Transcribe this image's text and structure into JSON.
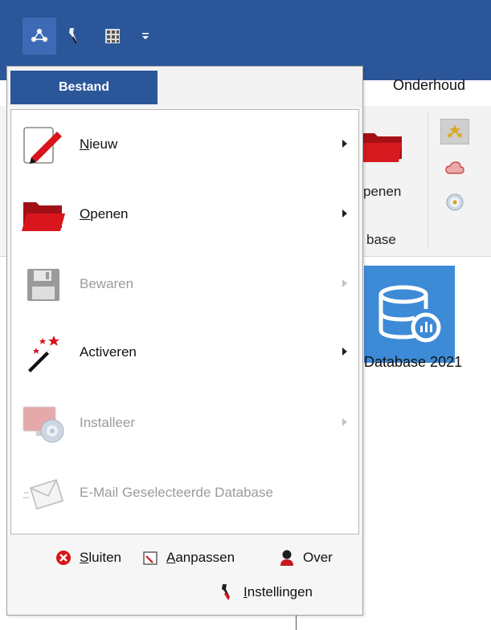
{
  "quick_access": {
    "icons": [
      "network-icon",
      "wrench-icon",
      "grid-icon",
      "customize-qat-icon"
    ],
    "colors": {
      "bar": "#2b579a",
      "active": "#3c6ab4"
    }
  },
  "ribbon": {
    "tab_right": "Onderhoud",
    "open_label": "penen",
    "group_label": "base",
    "small_icons": [
      "stars-icon",
      "cloud-icon",
      "cd-icon"
    ]
  },
  "database_tile": {
    "label": "Database 2021",
    "color": "#3d8ad6"
  },
  "file_menu": {
    "tab_label": "Bestand",
    "items": [
      {
        "label_hotkey": "N",
        "label_rest": "ieuw",
        "icon": "new-document-icon",
        "enabled": true,
        "has_submenu": true
      },
      {
        "label_hotkey": "O",
        "label_rest": "penen",
        "icon": "open-folder-icon",
        "enabled": true,
        "has_submenu": true
      },
      {
        "label": "Bewaren",
        "icon": "save-icon",
        "enabled": false,
        "has_submenu": true
      },
      {
        "label": "Activeren",
        "icon": "magic-wand-icon",
        "enabled": true,
        "has_submenu": true
      },
      {
        "label": "Installeer",
        "icon": "install-disc-icon",
        "enabled": false,
        "has_submenu": true
      },
      {
        "label": "E-Mail Geselecteerde Database",
        "icon": "envelope-icon",
        "enabled": false,
        "has_submenu": false
      }
    ],
    "footer": {
      "close": {
        "hotkey": "S",
        "rest": "luiten",
        "icon": "close-circle-icon"
      },
      "customize": {
        "hotkey": "A",
        "rest": "anpassen",
        "icon": "customize-icon"
      },
      "about": {
        "label": "Over",
        "icon": "user-icon"
      },
      "settings": {
        "hotkey": "I",
        "rest": "nstellingen",
        "icon": "settings-wrench-icon"
      }
    }
  }
}
